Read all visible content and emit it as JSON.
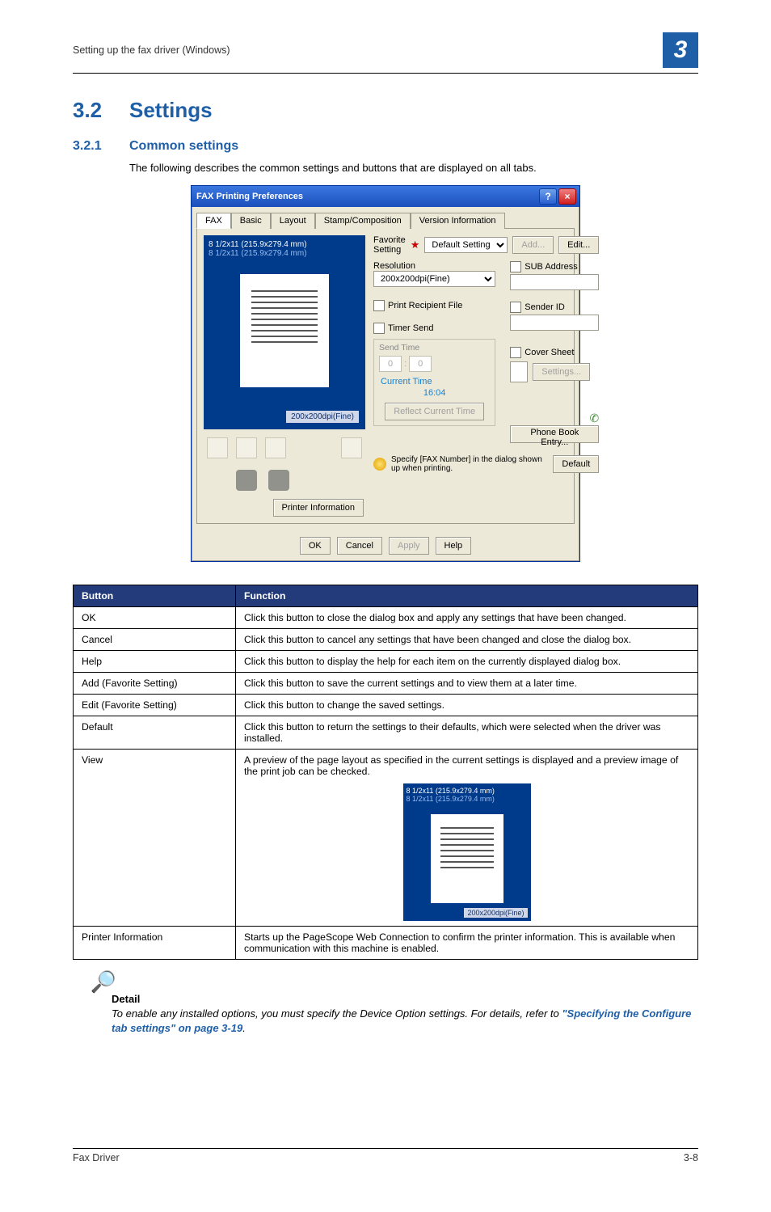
{
  "header": {
    "section_title": "Setting up the fax driver (Windows)",
    "chapter_number": "3"
  },
  "headings": {
    "h32_num": "3.2",
    "h32_text": "Settings",
    "h321_num": "3.2.1",
    "h321_text": "Common settings",
    "intro": "The following describes the common settings and buttons that are displayed on all tabs."
  },
  "dialog": {
    "title": "FAX Printing Preferences",
    "help_btn": "?",
    "close_btn": "×",
    "tabs": [
      "FAX",
      "Basic",
      "Layout",
      "Stamp/Composition",
      "Version Information"
    ],
    "active_tab": 0,
    "preview": {
      "line1": "8 1/2x11 (215.9x279.4 mm)",
      "line2": "8 1/2x11 (215.9x279.4 mm)",
      "mode": "200x200dpi(Fine)"
    },
    "printer_info_btn": "Printer Information",
    "favorite": {
      "label": "Favorite Setting",
      "selected": "Default Setting",
      "add_btn": "Add...",
      "edit_btn": "Edit..."
    },
    "resolution": {
      "label": "Resolution",
      "selected": "200x200dpi(Fine)"
    },
    "sub_address": {
      "label": "SUB Address"
    },
    "print_recipient": {
      "label": "Print Recipient File"
    },
    "sender_id": {
      "label": "Sender ID"
    },
    "timer_send": {
      "label": "Timer Send",
      "send_time": "Send Time",
      "hour": "0",
      "min": "0",
      "current_time_label": "Current Time",
      "current_time_value": "16:04",
      "reflect_btn": "Reflect Current Time"
    },
    "cover_sheet": {
      "label": "Cover Sheet",
      "settings_btn": "Settings..."
    },
    "phone_book_btn": "Phone Book Entry...",
    "message": "Specify [FAX Number] in the dialog shown up when printing.",
    "default_btn": "Default",
    "ok_btn": "OK",
    "cancel_btn": "Cancel",
    "apply_btn": "Apply",
    "help_btn2": "Help"
  },
  "table": {
    "col1": "Button",
    "col2": "Function",
    "rows": [
      {
        "c1": "OK",
        "c2": "Click this button to close the dialog box and apply any settings that have been changed."
      },
      {
        "c1": "Cancel",
        "c2": "Click this button to cancel any settings that have been changed and close the dialog box."
      },
      {
        "c1": "Help",
        "c2": "Click this button to display the help for each item on the currently displayed dialog box."
      },
      {
        "c1": "Add (Favorite Setting)",
        "c2": "Click this button to save the current settings and to view them at a later time."
      },
      {
        "c1": "Edit (Favorite Setting)",
        "c2": "Click this button to change the saved settings."
      },
      {
        "c1": "Default",
        "c2": "Click this button to return the settings to their defaults, which were selected when the driver was installed."
      },
      {
        "c1": "View",
        "c2": "A preview of the page layout as specified in the current settings is displayed and a preview image of the print job can be checked."
      },
      {
        "c1": "Printer Information",
        "c2": "Starts up the PageScope Web Connection to confirm the printer information. This is available when communication with this machine is enabled."
      }
    ],
    "view_preview": {
      "line1": "8 1/2x11 (215.9x279.4 mm)",
      "line2": "8 1/2x11 (215.9x279.4 mm)",
      "mode": "200x200dpi(Fine)"
    }
  },
  "detail": {
    "head": "Detail",
    "body_pre": "To enable any installed options, you must specify the Device Option settings. For details, refer to ",
    "link": "\"Specifying the Configure tab settings\" on page 3-19",
    "body_post": "."
  },
  "footer": {
    "left": "Fax Driver",
    "right": "3-8"
  }
}
